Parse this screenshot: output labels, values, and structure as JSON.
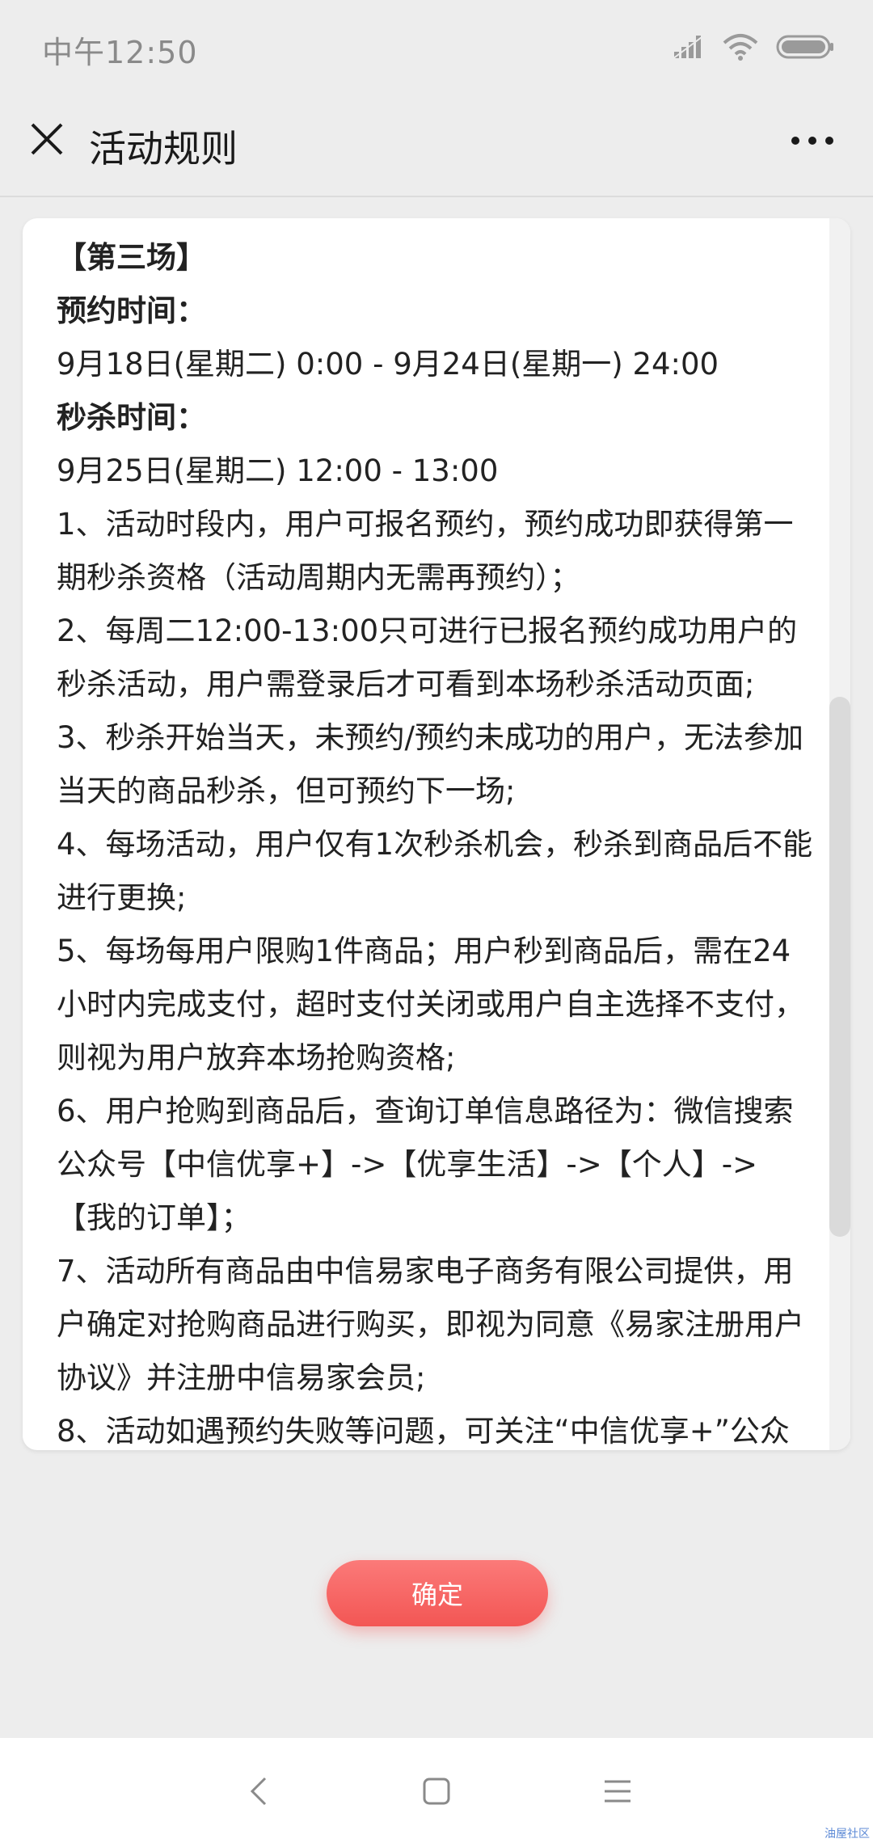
{
  "status_bar": {
    "time": "中午12:50",
    "icons": [
      "signal-icon",
      "wifi-icon",
      "battery-icon"
    ]
  },
  "nav": {
    "close_icon": "close-icon",
    "title": "活动规则",
    "more_icon": "more-icon"
  },
  "rules": {
    "session_title": "【第三场】",
    "reservation_label": "预约时间：",
    "reservation_time": "9月18日(星期二) 0:00 - 9月24日(星期一) 24:00",
    "flash_sale_label": "秒杀时间：",
    "flash_sale_time": "9月25日(星期二) 12:00 - 13:00",
    "items": [
      "1、活动时段内，用户可报名预约，预约成功即获得第一期秒杀资格（活动周期内无需再预约）；",
      "2、每周二12:00-13:00只可进行已报名预约成功用户的秒杀活动，用户需登录后才可看到本场秒杀活动页面;",
      "3、秒杀开始当天，未预约/预约未成功的用户，无法参加当天的商品秒杀，但可预约下一场;",
      "4、每场活动，用户仅有1次秒杀机会，秒杀到商品后不能进行更换;",
      "5、每场每用户限购1件商品；用户秒到商品后，需在24小时内完成支付，超时支付关闭或用户自主选择不支付，则视为用户放弃本场抢购资格;",
      "6、用户抢购到商品后，查询订单信息路径为：微信搜索公众号【中信优享+】->【优享生活】->【个人】->【我的订单】；",
      "7、活动所有商品由中信易家电子商务有限公司提供，用户确定对抢购商品进行购买，即视为同意《易家注册用户协议》并注册中信易家会员;",
      "8、活动如遇预约失败等问题，可关注“中信优享+”公众"
    ]
  },
  "confirm_label": "确定",
  "bottom_nav": {
    "icons": [
      "back-icon",
      "home-icon",
      "menu-icon"
    ]
  },
  "watermark": "油屋社区",
  "colors": {
    "accent": "#f35654",
    "background": "#ededed",
    "card": "#ffffff"
  }
}
